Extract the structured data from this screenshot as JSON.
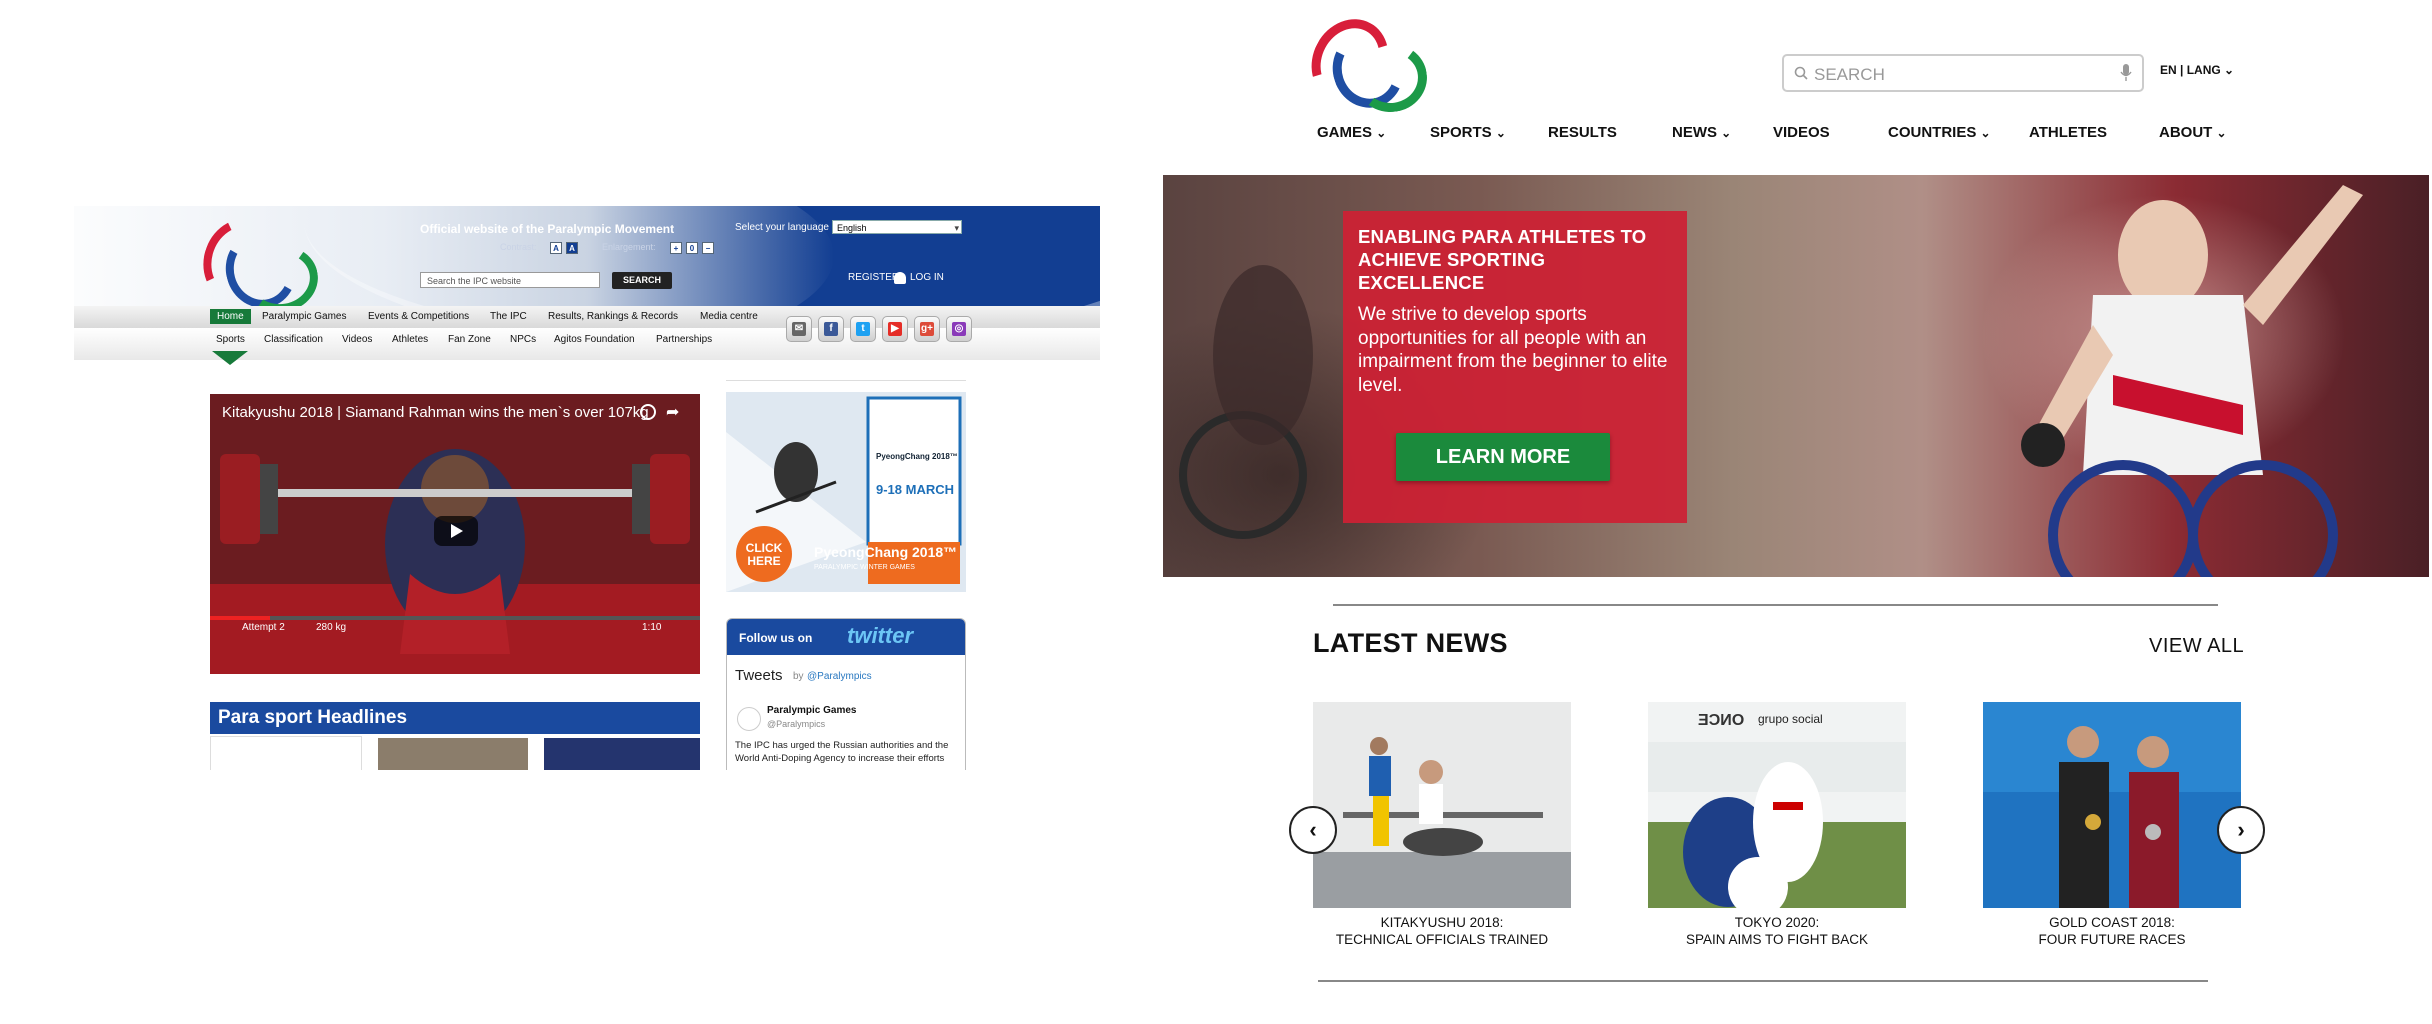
{
  "old_site": {
    "tagline": "Official website of the Paralympic Movement",
    "select_language_label": "Select your language",
    "language_value": "English",
    "contrast_label": "Contrast:",
    "enlargement_label": "Enlargement:",
    "search_placeholder": "Search the IPC website",
    "search_button": "SEARCH",
    "register": "REGISTER",
    "login": "LOG IN",
    "nav_primary": [
      "Home",
      "Paralympic Games",
      "Events & Competitions",
      "The IPC",
      "Results, Rankings & Records",
      "Media centre"
    ],
    "nav_secondary": [
      "Sports",
      "Classification",
      "Videos",
      "Athletes",
      "Fan Zone",
      "NPCs",
      "Agitos Foundation",
      "Partnerships"
    ],
    "video_title": "Kitakyushu 2018 | Siamand Rahman wins the men`s over 107kg",
    "video_attempt": "Attempt 2",
    "video_weight": "280 kg",
    "video_time": "1:10",
    "headlines": "Para sport Headlines",
    "ad": {
      "brand": "PyeongChang 2018™",
      "dates": "9-18 MARCH",
      "click": "CLICK HERE",
      "banner": "PyeongChang 2018™",
      "sub": "PARALYMPIC WINTER GAMES"
    },
    "twitter": {
      "follow": "Follow us on",
      "brand": "twitter",
      "tweets": "Tweets",
      "by": "by",
      "handle": "@Paralympics",
      "account": "Paralympic Games",
      "tweet_text": "The IPC has urged the Russian authorities and the World Anti-Doping Agency to increase their efforts"
    }
  },
  "new_site": {
    "search_placeholder": "SEARCH",
    "lang": "EN | LANG",
    "nav": [
      "GAMES",
      "SPORTS",
      "RESULTS",
      "NEWS",
      "VIDEOS",
      "COUNTRIES",
      "ATHLETES",
      "ABOUT"
    ],
    "hero": {
      "heading": "ENABLING PARA ATHLETES TO ACHIEVE SPORTING EXCELLENCE",
      "body": "We strive to develop sports opportunities for all people with an impairment from the beginner to elite level.",
      "cta": "LEARN MORE"
    },
    "latest_news": "LATEST NEWS",
    "view_all": "VIEW ALL",
    "news": [
      {
        "line1": "KITAKYUSHU 2018:",
        "line2": "TECHNICAL OFFICIALS TRAINED"
      },
      {
        "line1": "TOKYO 2020:",
        "line2": "SPAIN AIMS TO FIGHT BACK"
      },
      {
        "line1": "GOLD COAST 2018:",
        "line2": "FOUR FUTURE RACES"
      }
    ],
    "news_image_text": {
      "sign": "grupo social",
      "once": "ONCE"
    }
  },
  "colors": {
    "agitos_red": "#d81e3a",
    "agitos_blue": "#1f4ea3",
    "agitos_green": "#1c9a48",
    "old_header_blue": "#123e92",
    "hero_card_red": "#cd2034",
    "cta_green": "#1b8a3c"
  }
}
